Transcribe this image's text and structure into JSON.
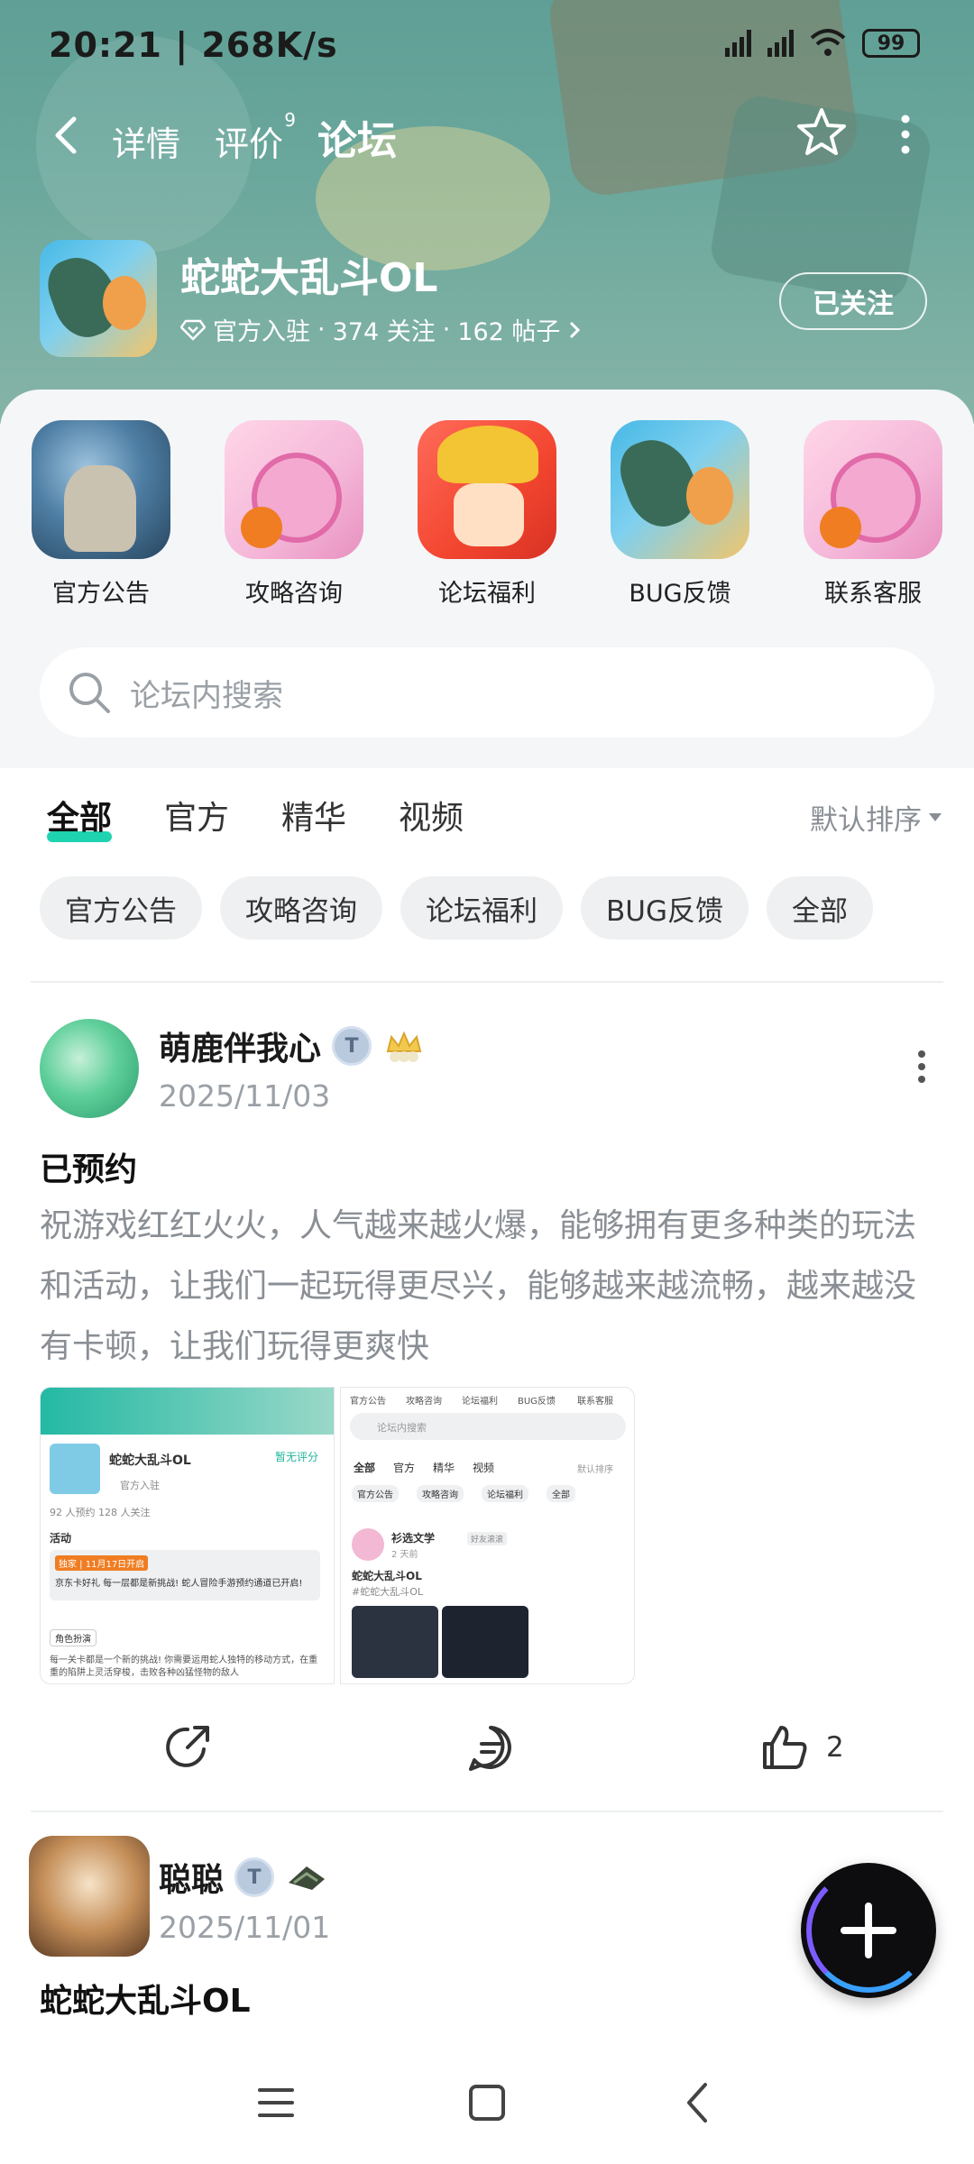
{
  "status_bar": {
    "time": "20:21",
    "speed": "268K/s",
    "battery": "99"
  },
  "top_nav": {
    "tabs": [
      {
        "label": "详情",
        "badge": ""
      },
      {
        "label": "评价",
        "badge": "9"
      },
      {
        "label": "论坛",
        "badge": ""
      }
    ],
    "active_tab": "论坛"
  },
  "game": {
    "title": "蛇蛇大乱斗OL",
    "verified_label": "官方入驻",
    "followers": "374 关注",
    "posts": "162 帖子",
    "follow_button": "已关注",
    "separator": "·"
  },
  "shortcuts": [
    {
      "label": "官方公告"
    },
    {
      "label": "攻略咨询"
    },
    {
      "label": "论坛福利"
    },
    {
      "label": "BUG反馈"
    },
    {
      "label": "联系客服"
    }
  ],
  "search": {
    "placeholder": "论坛内搜索"
  },
  "filter_tabs": [
    {
      "label": "全部",
      "active": true
    },
    {
      "label": "官方",
      "active": false
    },
    {
      "label": "精华",
      "active": false
    },
    {
      "label": "视频",
      "active": false
    }
  ],
  "sort_label": "默认排序",
  "chips": [
    "官方公告",
    "攻略咨询",
    "论坛福利",
    "BUG反馈",
    "全部"
  ],
  "posts": [
    {
      "author": "萌鹿伴我心",
      "date": "2025/11/03",
      "title": "已预约",
      "body": "祝游戏红红火火，人气越来越火爆，能够拥有更多种类的玩法和活动，让我们一起玩得更尽兴，能够越来越流畅，越来越没有卡顿，让我们玩得更爽快",
      "likes": "2",
      "thumb1": {
        "game": "蛇蛇大乱斗OL",
        "rating": "暂无评分",
        "official": "官方入驻",
        "stats": "92 人预约   128 人关注",
        "activity": "活动",
        "event_tag": "独家 | 11月17日开启",
        "event_text": "京东卡好礼 每一层都是新挑战! 蛇人冒险手游预约通道已开启!",
        "role_tag": "角色扮演",
        "desc": "每一关卡都是一个新的挑战! 你需要运用蛇人独特的移动方式，在重重的陷阱上灵活穿梭，击败各种凶猛怪物的敌人"
      },
      "thumb2": {
        "tabs": [
          "官方公告",
          "攻略咨询",
          "论坛福利",
          "BUG反馈",
          "联系客服"
        ],
        "search": "论坛内搜索",
        "filter": [
          "全部",
          "官方",
          "精华",
          "视频"
        ],
        "sort": "默认排序",
        "chips": [
          "官方公告",
          "攻略咨询",
          "论坛福利",
          "全部"
        ],
        "author": "衫选文学",
        "author_tag": "好友滚滚",
        "time": "2 天前",
        "title": "蛇蛇大乱斗OL",
        "tag": "#蛇蛇大乱斗OL"
      }
    },
    {
      "author": "聪聪",
      "date": "2025/11/01",
      "title": "蛇蛇大乱斗OL"
    }
  ],
  "colors": {
    "accent": "#1fd3b0",
    "banner": "#6aa79c",
    "muted_text": "#9aa0a6"
  }
}
